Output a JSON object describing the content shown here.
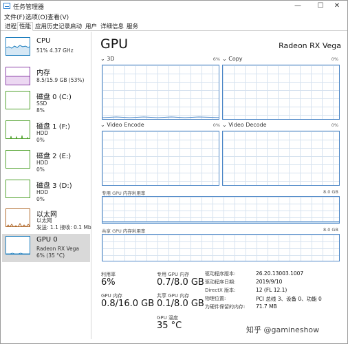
{
  "window": {
    "title": "任务管理器",
    "min_glyph": "—",
    "max_glyph": "☐",
    "close_glyph": "✕"
  },
  "menu": [
    "文件(F)",
    "选项(O)",
    "查看(V)"
  ],
  "tabs": [
    "进程",
    "性能",
    "应用历史记录",
    "启动",
    "用户",
    "详细信息",
    "服务"
  ],
  "active_tab": "性能",
  "sidebar": {
    "items": [
      {
        "name": "CPU",
        "sub1": "51% 4.37 GHz",
        "sub2": ""
      },
      {
        "name": "内存",
        "sub1": "8.5/15.9 GB (53%)",
        "sub2": ""
      },
      {
        "name": "磁盘 0 (C:)",
        "sub1": "SSD",
        "sub2": "8%"
      },
      {
        "name": "磁盘 1 (F:)",
        "sub1": "HDD",
        "sub2": "0%"
      },
      {
        "name": "磁盘 2 (E:)",
        "sub1": "HDD",
        "sub2": "0%"
      },
      {
        "name": "磁盘 3 (D:)",
        "sub1": "HDD",
        "sub2": "0%"
      },
      {
        "name": "以太网",
        "sub1": "以太网",
        "sub2": "发送: 1.1 接收: 0.1 Mb"
      },
      {
        "name": "GPU 0",
        "sub1": "Radeon RX Vega",
        "sub2": "6% (35 °C)"
      }
    ],
    "selected_index": 7
  },
  "main": {
    "title": "GPU",
    "model": "Radeon RX Vega",
    "engines": [
      {
        "label": "3D",
        "percent": "6%"
      },
      {
        "label": "Copy",
        "percent": "0%"
      },
      {
        "label": "Video Encode",
        "percent": "0%"
      },
      {
        "label": "Video Decode",
        "percent": "0%"
      }
    ],
    "dedicated_label": "专用 GPU 内存利用率",
    "dedicated_max": "8.0 GB",
    "shared_label": "共享 GPU 内存利用率",
    "shared_max": "8.0 GB",
    "stats": {
      "util_label": "利用率",
      "util_value": "6%",
      "ded_label": "专用 GPU 内存",
      "ded_value": "0.7/8.0 GB",
      "gpumem_label": "GPU 内存",
      "gpumem_value": "0.8/16.0 GB",
      "shared_label": "共享 GPU 内存",
      "shared_value": "0.1/8.0 GB",
      "temp_label": "GPU 温度",
      "temp_value": "35 °C"
    },
    "info": [
      {
        "label": "驱动程序版本:",
        "value": "26.20.13003.1007"
      },
      {
        "label": "驱动程序日期:",
        "value": "2019/9/10"
      },
      {
        "label": "DirectX 版本:",
        "value": "12 (FL 12.1)"
      },
      {
        "label": "物理位置:",
        "value": "PCI 总线 3、设备 0、功能 0"
      },
      {
        "label": "为硬件保留的内存:",
        "value": "71.7 MB"
      }
    ]
  },
  "watermark": "知乎 @gamineshow",
  "colors": {
    "cpu": "#1f7fbf",
    "memory": "#8b3fa8",
    "disk": "#4fa12b",
    "ethernet": "#b0682a",
    "gpu": "#1f7fbf"
  }
}
